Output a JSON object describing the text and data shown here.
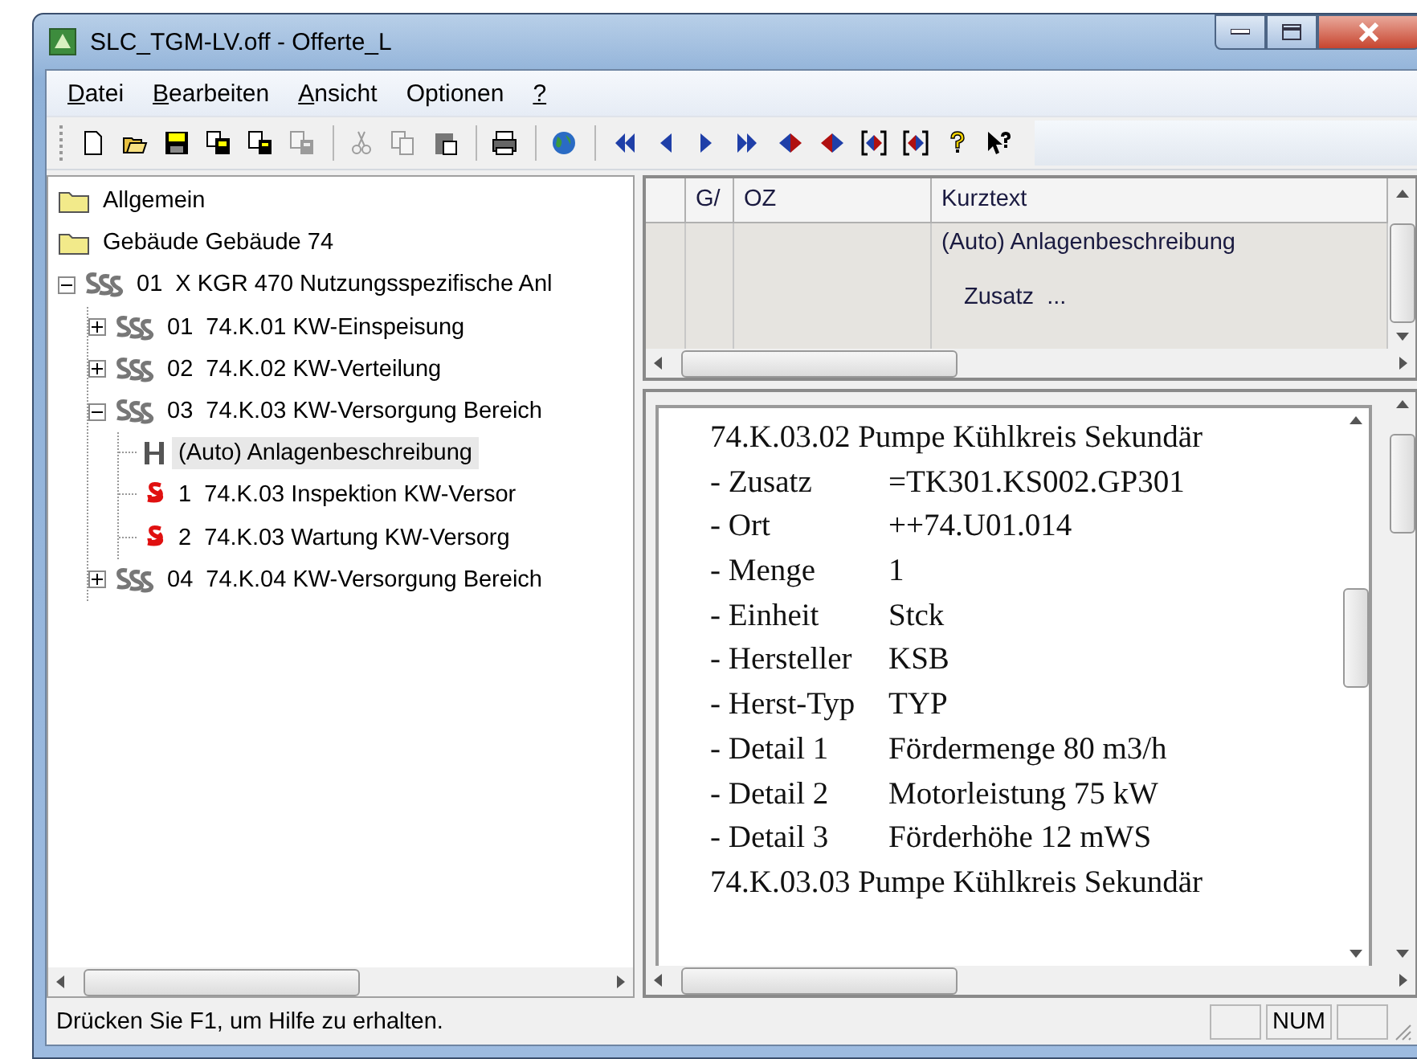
{
  "window": {
    "title": "SLC_TGM-LV.off - Offerte_L"
  },
  "menu": [
    {
      "accel": "D",
      "text": "atei"
    },
    {
      "accel": "B",
      "text": "earbeiten"
    },
    {
      "accel": "A",
      "text": "nsicht"
    },
    {
      "text": "Optionen"
    },
    {
      "accel": "?"
    }
  ],
  "toolbar": [
    {
      "kind": "new",
      "disabled": false
    },
    {
      "kind": "open",
      "disabled": false
    },
    {
      "kind": "save",
      "disabled": false
    },
    {
      "kind": "copy-doc",
      "disabled": false
    },
    {
      "kind": "move-doc",
      "disabled": false
    },
    {
      "kind": "move-doc",
      "disabled": true
    },
    {
      "kind": "separator"
    },
    {
      "kind": "cut",
      "disabled": true
    },
    {
      "kind": "copy",
      "disabled": true
    },
    {
      "kind": "paste",
      "disabled": false
    },
    {
      "kind": "separator"
    },
    {
      "kind": "print",
      "disabled": false
    },
    {
      "kind": "separator"
    },
    {
      "kind": "globe",
      "disabled": false
    },
    {
      "kind": "separator"
    },
    {
      "kind": "first",
      "disabled": false
    },
    {
      "kind": "prev",
      "disabled": false
    },
    {
      "kind": "next",
      "disabled": false
    },
    {
      "kind": "last",
      "disabled": false
    },
    {
      "kind": "diamond-prev",
      "disabled": false
    },
    {
      "kind": "diamond-next",
      "disabled": false
    },
    {
      "kind": "bracket-prev",
      "disabled": false
    },
    {
      "kind": "bracket-next",
      "disabled": false
    },
    {
      "kind": "help",
      "disabled": false
    },
    {
      "kind": "context-help",
      "disabled": false
    }
  ],
  "tree": [
    {
      "kind": "folder",
      "label": "Allgemein",
      "selected": false
    },
    {
      "kind": "folder",
      "label": "Gebäude Gebäude 74",
      "selected": false
    },
    {
      "kind": "group",
      "label": "01  X KGR 470 Nutzungsspezifische Anl",
      "selected": false,
      "expanded": true,
      "children": [
        {
          "kind": "group",
          "label": "01  74.K.01 KW-Einspeisung",
          "selected": false,
          "expanded": false
        },
        {
          "kind": "group",
          "label": "02  74.K.02 KW-Verteilung",
          "selected": false,
          "expanded": false
        },
        {
          "kind": "group",
          "label": "03  74.K.03 KW-Versorgung Bereich",
          "selected": false,
          "expanded": true,
          "children": [
            {
              "kind": "heading",
              "label": "(Auto) Anlagenbeschreibung",
              "selected": true
            },
            {
              "kind": "item",
              "label": "1  74.K.03 Inspektion KW-Versor",
              "selected": false
            },
            {
              "kind": "item",
              "label": "2  74.K.03 Wartung KW-Versorg",
              "selected": false
            }
          ]
        },
        {
          "kind": "group",
          "label": "04  74.K.04 KW-Versorgung Bereich",
          "selected": false,
          "expanded": false
        }
      ]
    }
  ],
  "table": {
    "columns": [
      "G/",
      "OZ",
      "Kurztext"
    ],
    "rows": [
      {
        "kurztext": "(Auto) Anlagenbeschreibung",
        "zusatz": "Zusatz  ..."
      }
    ]
  },
  "document": {
    "lines": [
      {
        "kind": "heading",
        "text": "74.K.03.02 Pumpe Kühlkreis Sekundär"
      },
      {
        "kind": "field",
        "label": "- Zusatz",
        "value": "=TK301.KS002.GP301"
      },
      {
        "kind": "field",
        "label": "- Ort",
        "value": "++74.U01.014"
      },
      {
        "kind": "field",
        "label": "- Menge",
        "value": "1"
      },
      {
        "kind": "field",
        "label": "- Einheit",
        "value": "Stck"
      },
      {
        "kind": "field",
        "label": "- Hersteller",
        "value": "KSB"
      },
      {
        "kind": "field",
        "label": "- Herst-Typ",
        "value": "TYP"
      },
      {
        "kind": "field",
        "label": "- Detail 1",
        "value": "Fördermenge 80 m3/h"
      },
      {
        "kind": "field",
        "label": "- Detail 2",
        "value": "Motorleistung 75 kW"
      },
      {
        "kind": "field",
        "label": "- Detail 3",
        "value": "Förderhöhe 12 mWS"
      },
      {
        "kind": "heading",
        "text": "74.K.03.03 Pumpe Kühlkreis Sekundär"
      }
    ]
  },
  "status_bar": {
    "text": "Drücken Sie F1, um Hilfe zu erhalten.",
    "panels": [
      {
        "kind": "empty"
      },
      {
        "kind": "text",
        "label": "NUM"
      },
      {
        "kind": "empty"
      }
    ]
  }
}
